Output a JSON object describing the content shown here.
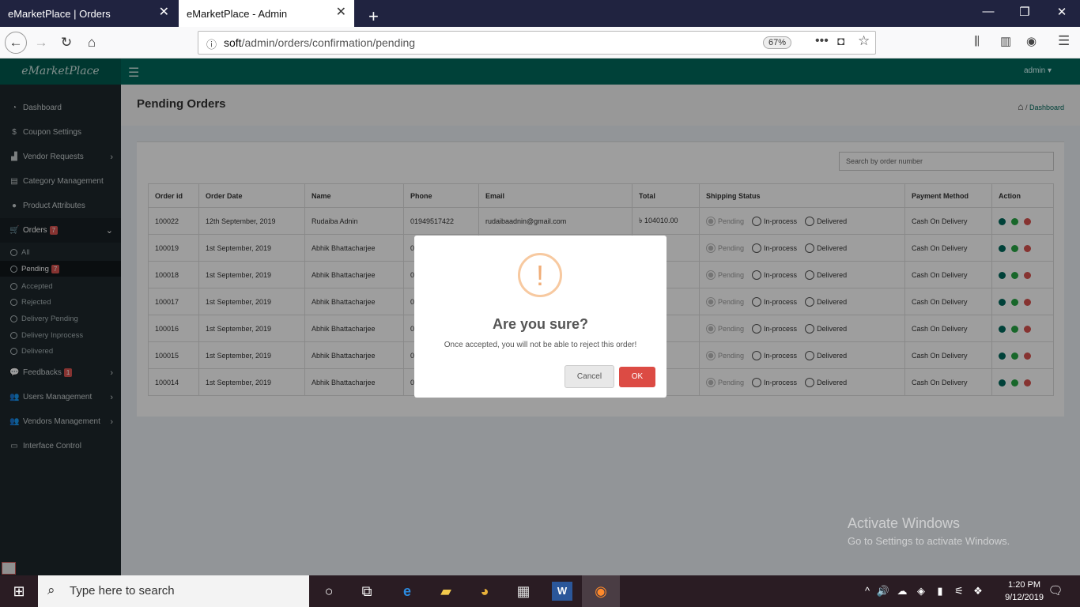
{
  "browser": {
    "tabs": [
      {
        "title": "eMarketPlace | Orders"
      },
      {
        "title": "eMarketPlace - Admin"
      }
    ],
    "url_host": "soft",
    "url_path": "/admin/orders/confirmation/pending",
    "zoom": "67%"
  },
  "app": {
    "logo": "eMarketPlace",
    "user": "admin ▾"
  },
  "sidebar": {
    "items": [
      {
        "label": "Dashboard",
        "icon": "dashboard-icon"
      },
      {
        "label": "Coupon Settings",
        "icon": "dollar-icon"
      },
      {
        "label": "Vendor Requests",
        "icon": "chart-icon"
      },
      {
        "label": "Category Management",
        "icon": "list-icon"
      },
      {
        "label": "Product Attributes",
        "icon": "circle-icon"
      },
      {
        "label": "Orders",
        "icon": "cart-icon",
        "badge": "7"
      },
      {
        "label": "Feedbacks",
        "icon": "comments-icon",
        "badge": "1"
      },
      {
        "label": "Users Management",
        "icon": "users-icon"
      },
      {
        "label": "Vendors Management",
        "icon": "users-icon"
      },
      {
        "label": "Interface Control",
        "icon": "monitor-icon"
      }
    ],
    "order_sub": [
      {
        "label": "All"
      },
      {
        "label": "Pending",
        "badge": "7"
      },
      {
        "label": "Accepted"
      },
      {
        "label": "Rejected"
      },
      {
        "label": "Delivery Pending"
      },
      {
        "label": "Delivery Inprocess"
      },
      {
        "label": "Delivered"
      }
    ]
  },
  "page": {
    "title": "Pending Orders",
    "breadcrumb": "Dashboard",
    "search_placeholder": "Search by order number"
  },
  "table": {
    "headers": [
      "Order id",
      "Order Date",
      "Name",
      "Phone",
      "Email",
      "Total",
      "Shipping Status",
      "Payment Method",
      "Action"
    ],
    "shipping_options": [
      "Pending",
      "In-process",
      "Delivered"
    ],
    "rows": [
      {
        "id": "100022",
        "date": "12th September, 2019",
        "name": "Rudaiba Adnin",
        "phone": "01949517422",
        "email": "rudaibaadnin@gmail.com",
        "total": "৳ 104010.00",
        "payment": "Cash On Delivery"
      },
      {
        "id": "100019",
        "date": "1st September, 2019",
        "name": "Abhik Bhattacharjee",
        "phone": "0",
        "email": "",
        "total": ".00",
        "payment": "Cash On Delivery"
      },
      {
        "id": "100018",
        "date": "1st September, 2019",
        "name": "Abhik Bhattacharjee",
        "phone": "0",
        "email": "",
        "total": "5.00",
        "payment": "Cash On Delivery"
      },
      {
        "id": "100017",
        "date": "1st September, 2019",
        "name": "Abhik Bhattacharjee",
        "phone": "0",
        "email": "",
        "total": "5.00",
        "payment": "Cash On Delivery"
      },
      {
        "id": "100016",
        "date": "1st September, 2019",
        "name": "Abhik Bhattacharjee",
        "phone": "0",
        "email": "",
        "total": "5.00",
        "payment": "Cash On Delivery"
      },
      {
        "id": "100015",
        "date": "1st September, 2019",
        "name": "Abhik Bhattacharjee",
        "phone": "0",
        "email": "",
        "total": "5.00",
        "payment": "Cash On Delivery"
      },
      {
        "id": "100014",
        "date": "1st September, 2019",
        "name": "Abhik Bhattacharjee",
        "phone": "0",
        "email": "",
        "total": "5.00",
        "payment": "Cash On Delivery"
      }
    ]
  },
  "modal": {
    "icon": "!",
    "title": "Are you sure?",
    "text": "Once accepted, you will not be able to reject this order!",
    "cancel": "Cancel",
    "ok": "OK"
  },
  "watermark": {
    "line1": "Activate Windows",
    "line2": "Go to Settings to activate Windows."
  },
  "taskbar": {
    "search_placeholder": "Type here to search",
    "time": "1:20 PM",
    "date": "9/12/2019"
  }
}
